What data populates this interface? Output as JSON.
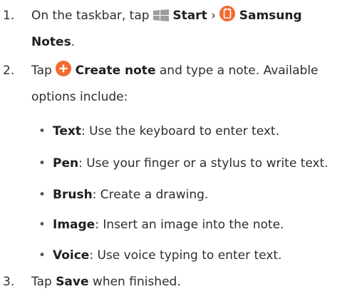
{
  "step1": {
    "number": "1.",
    "prefix": "On the taskbar, tap",
    "start": "Start",
    "separator": "›",
    "app": "Samsung",
    "app2": "Notes",
    "end": "."
  },
  "step2": {
    "number": "2.",
    "prefix": "Tap",
    "create": "Create note",
    "rest1": "and type a note. Available",
    "rest2": "options include:"
  },
  "bullets": [
    {
      "term": "Text",
      "desc": ": Use the keyboard to enter text."
    },
    {
      "term": "Pen",
      "desc": ": Use your finger or a stylus to write text."
    },
    {
      "term": "Brush",
      "desc": ": Create a drawing."
    },
    {
      "term": "Image",
      "desc": ": Insert an image into the note."
    },
    {
      "term": "Voice",
      "desc": ": Use voice typing to enter text."
    }
  ],
  "bullet_char": "•",
  "step3": {
    "number": "3.",
    "prefix": "Tap",
    "save": "Save",
    "suffix": "when finished."
  },
  "icons": {
    "start": "windows-start-icon",
    "notes": "samsung-notes-icon",
    "create": "create-note-plus-icon"
  },
  "colors": {
    "windows_icon": "#9e9e9e",
    "notes_icon": "#f26a2e",
    "create_icon": "#f26a2e"
  }
}
